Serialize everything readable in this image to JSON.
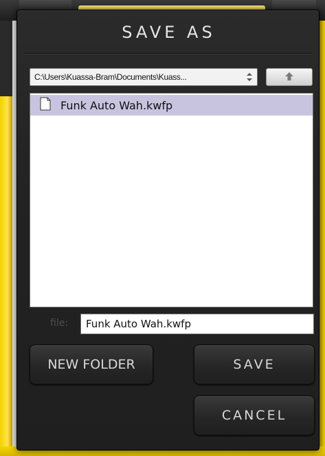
{
  "dialog": {
    "title": "SAVE AS",
    "path": "C:\\Users\\Kuassa-Bram\\Documents\\Kuass...",
    "path_arrows_icon": "up-down-arrows-icon",
    "up_icon": "arrow-up-icon",
    "files": [
      {
        "name": "Funk Auto Wah.kwfp",
        "icon": "document-icon",
        "selected": true
      }
    ],
    "file_label": "file:",
    "file_value": "Funk Auto Wah.kwfp",
    "buttons": {
      "new_folder": "NEW FOLDER",
      "save": "SAVE",
      "cancel": "CANCEL"
    }
  },
  "colors": {
    "dialog_bg": "#232323",
    "selection": "#c8c4e0",
    "accent_yellow": "#f4d600",
    "button_text": "#d9d9d9"
  }
}
